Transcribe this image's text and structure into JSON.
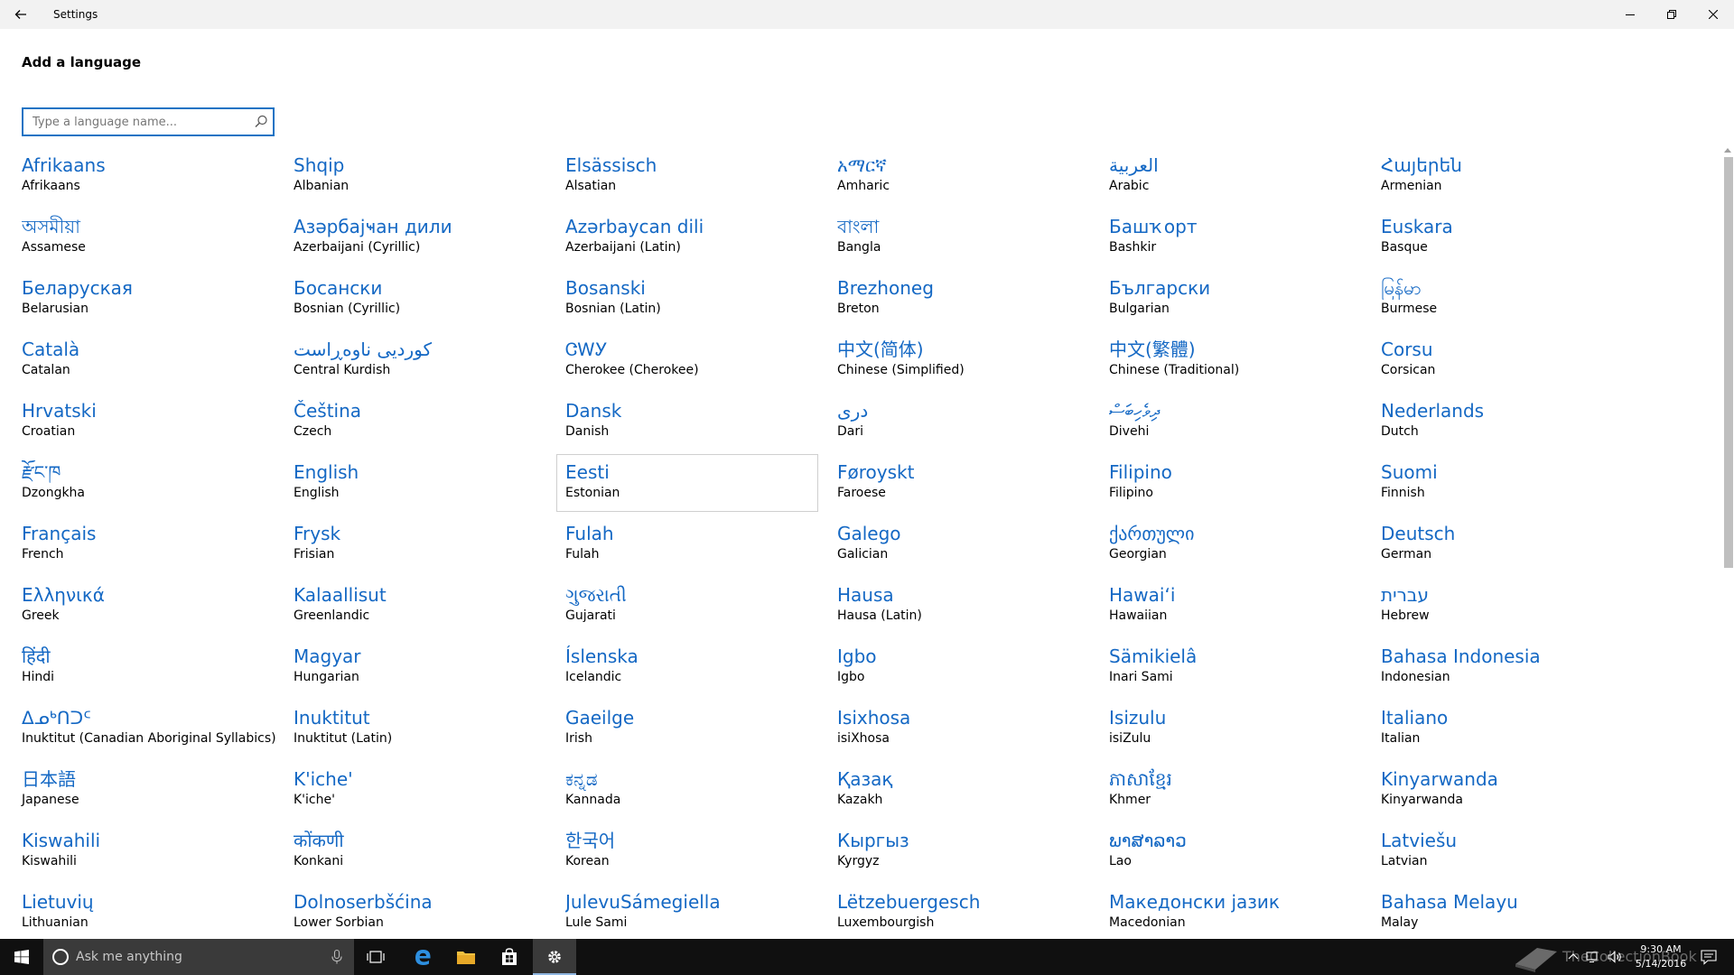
{
  "window": {
    "title": "Settings"
  },
  "page": {
    "title": "Add a language"
  },
  "search": {
    "placeholder": "Type a language name..."
  },
  "languages": [
    {
      "native": "Afrikaans",
      "english": "Afrikaans"
    },
    {
      "native": "Shqip",
      "english": "Albanian"
    },
    {
      "native": "Elsässisch",
      "english": "Alsatian"
    },
    {
      "native": "አማርኛ",
      "english": "Amharic"
    },
    {
      "native": "العربية",
      "english": "Arabic"
    },
    {
      "native": "Հայերեն",
      "english": "Armenian"
    },
    {
      "native": "অসমীয়া",
      "english": "Assamese"
    },
    {
      "native": "Азәрбајҹан дили",
      "english": "Azerbaijani (Cyrillic)"
    },
    {
      "native": "Azərbaycan dili",
      "english": "Azerbaijani (Latin)"
    },
    {
      "native": "বাংলা",
      "english": "Bangla"
    },
    {
      "native": "Башҡорт",
      "english": "Bashkir"
    },
    {
      "native": "Euskara",
      "english": "Basque"
    },
    {
      "native": "Беларуская",
      "english": "Belarusian"
    },
    {
      "native": "Босански",
      "english": "Bosnian (Cyrillic)"
    },
    {
      "native": "Bosanski",
      "english": "Bosnian (Latin)"
    },
    {
      "native": "Brezhoneg",
      "english": "Breton"
    },
    {
      "native": "Български",
      "english": "Bulgarian"
    },
    {
      "native": "မြန်မာ",
      "english": "Burmese"
    },
    {
      "native": "Català",
      "english": "Catalan"
    },
    {
      "native": "کوردیی ناوەڕاست",
      "english": "Central Kurdish"
    },
    {
      "native": "ᏣᎳᎩ",
      "english": "Cherokee (Cherokee)"
    },
    {
      "native": "中文(简体)",
      "english": "Chinese (Simplified)"
    },
    {
      "native": "中文(繁體)",
      "english": "Chinese (Traditional)"
    },
    {
      "native": "Corsu",
      "english": "Corsican"
    },
    {
      "native": "Hrvatski",
      "english": "Croatian"
    },
    {
      "native": "Čeština",
      "english": "Czech"
    },
    {
      "native": "Dansk",
      "english": "Danish"
    },
    {
      "native": "دری",
      "english": "Dari"
    },
    {
      "native": "ދިވެހިބަސް",
      "english": "Divehi"
    },
    {
      "native": "Nederlands",
      "english": "Dutch"
    },
    {
      "native": "རྫོང་ཁ",
      "english": "Dzongkha"
    },
    {
      "native": "English",
      "english": "English"
    },
    {
      "native": "Eesti",
      "english": "Estonian",
      "hovered": true
    },
    {
      "native": "Føroyskt",
      "english": "Faroese"
    },
    {
      "native": "Filipino",
      "english": "Filipino"
    },
    {
      "native": "Suomi",
      "english": "Finnish"
    },
    {
      "native": "Français",
      "english": "French"
    },
    {
      "native": "Frysk",
      "english": "Frisian"
    },
    {
      "native": "Fulah",
      "english": "Fulah"
    },
    {
      "native": "Galego",
      "english": "Galician"
    },
    {
      "native": "ქართული",
      "english": "Georgian"
    },
    {
      "native": "Deutsch",
      "english": "German"
    },
    {
      "native": "Ελληνικά",
      "english": "Greek"
    },
    {
      "native": "Kalaallisut",
      "english": "Greenlandic"
    },
    {
      "native": "ગુજરાતી",
      "english": "Gujarati"
    },
    {
      "native": "Hausa",
      "english": "Hausa (Latin)"
    },
    {
      "native": "Hawaiʻi",
      "english": "Hawaiian"
    },
    {
      "native": "עברית",
      "english": "Hebrew"
    },
    {
      "native": "हिंदी",
      "english": "Hindi"
    },
    {
      "native": "Magyar",
      "english": "Hungarian"
    },
    {
      "native": "Íslenska",
      "english": "Icelandic"
    },
    {
      "native": "Igbo",
      "english": "Igbo"
    },
    {
      "native": "Sämikielâ",
      "english": "Inari Sami"
    },
    {
      "native": "Bahasa Indonesia",
      "english": "Indonesian"
    },
    {
      "native": "ᐃᓄᒃᑎᑐᑦ",
      "english": "Inuktitut (Canadian Aboriginal Syllabics)"
    },
    {
      "native": "Inuktitut",
      "english": "Inuktitut (Latin)"
    },
    {
      "native": "Gaeilge",
      "english": "Irish"
    },
    {
      "native": "Isixhosa",
      "english": "isiXhosa"
    },
    {
      "native": "Isizulu",
      "english": "isiZulu"
    },
    {
      "native": "Italiano",
      "english": "Italian"
    },
    {
      "native": "日本語",
      "english": "Japanese"
    },
    {
      "native": "K'iche'",
      "english": "K'iche'"
    },
    {
      "native": "ಕನ್ನಡ",
      "english": "Kannada"
    },
    {
      "native": "Қазақ",
      "english": "Kazakh"
    },
    {
      "native": "ភាសាខ្មែរ",
      "english": "Khmer"
    },
    {
      "native": "Kinyarwanda",
      "english": "Kinyarwanda"
    },
    {
      "native": "Kiswahili",
      "english": "Kiswahili"
    },
    {
      "native": "कोंकणी",
      "english": "Konkani"
    },
    {
      "native": "한국어",
      "english": "Korean"
    },
    {
      "native": "Кыргыз",
      "english": "Kyrgyz"
    },
    {
      "native": "ພາສາລາວ",
      "english": "Lao"
    },
    {
      "native": "Latviešu",
      "english": "Latvian"
    },
    {
      "native": "Lietuvių",
      "english": "Lithuanian"
    },
    {
      "native": "Dolnoserbšćina",
      "english": "Lower Sorbian"
    },
    {
      "native": "JulevuSámegiella",
      "english": "Lule Sami"
    },
    {
      "native": "Lëtzebuergesch",
      "english": "Luxembourgish"
    },
    {
      "native": "Македонски јазик",
      "english": "Macedonian"
    },
    {
      "native": "Bahasa Melayu",
      "english": "Malay"
    }
  ],
  "taskbar": {
    "search_text": "Ask me anything",
    "watermark": "TheCollectionBook",
    "time": "9:30 AM",
    "date": "5/14/2016"
  }
}
